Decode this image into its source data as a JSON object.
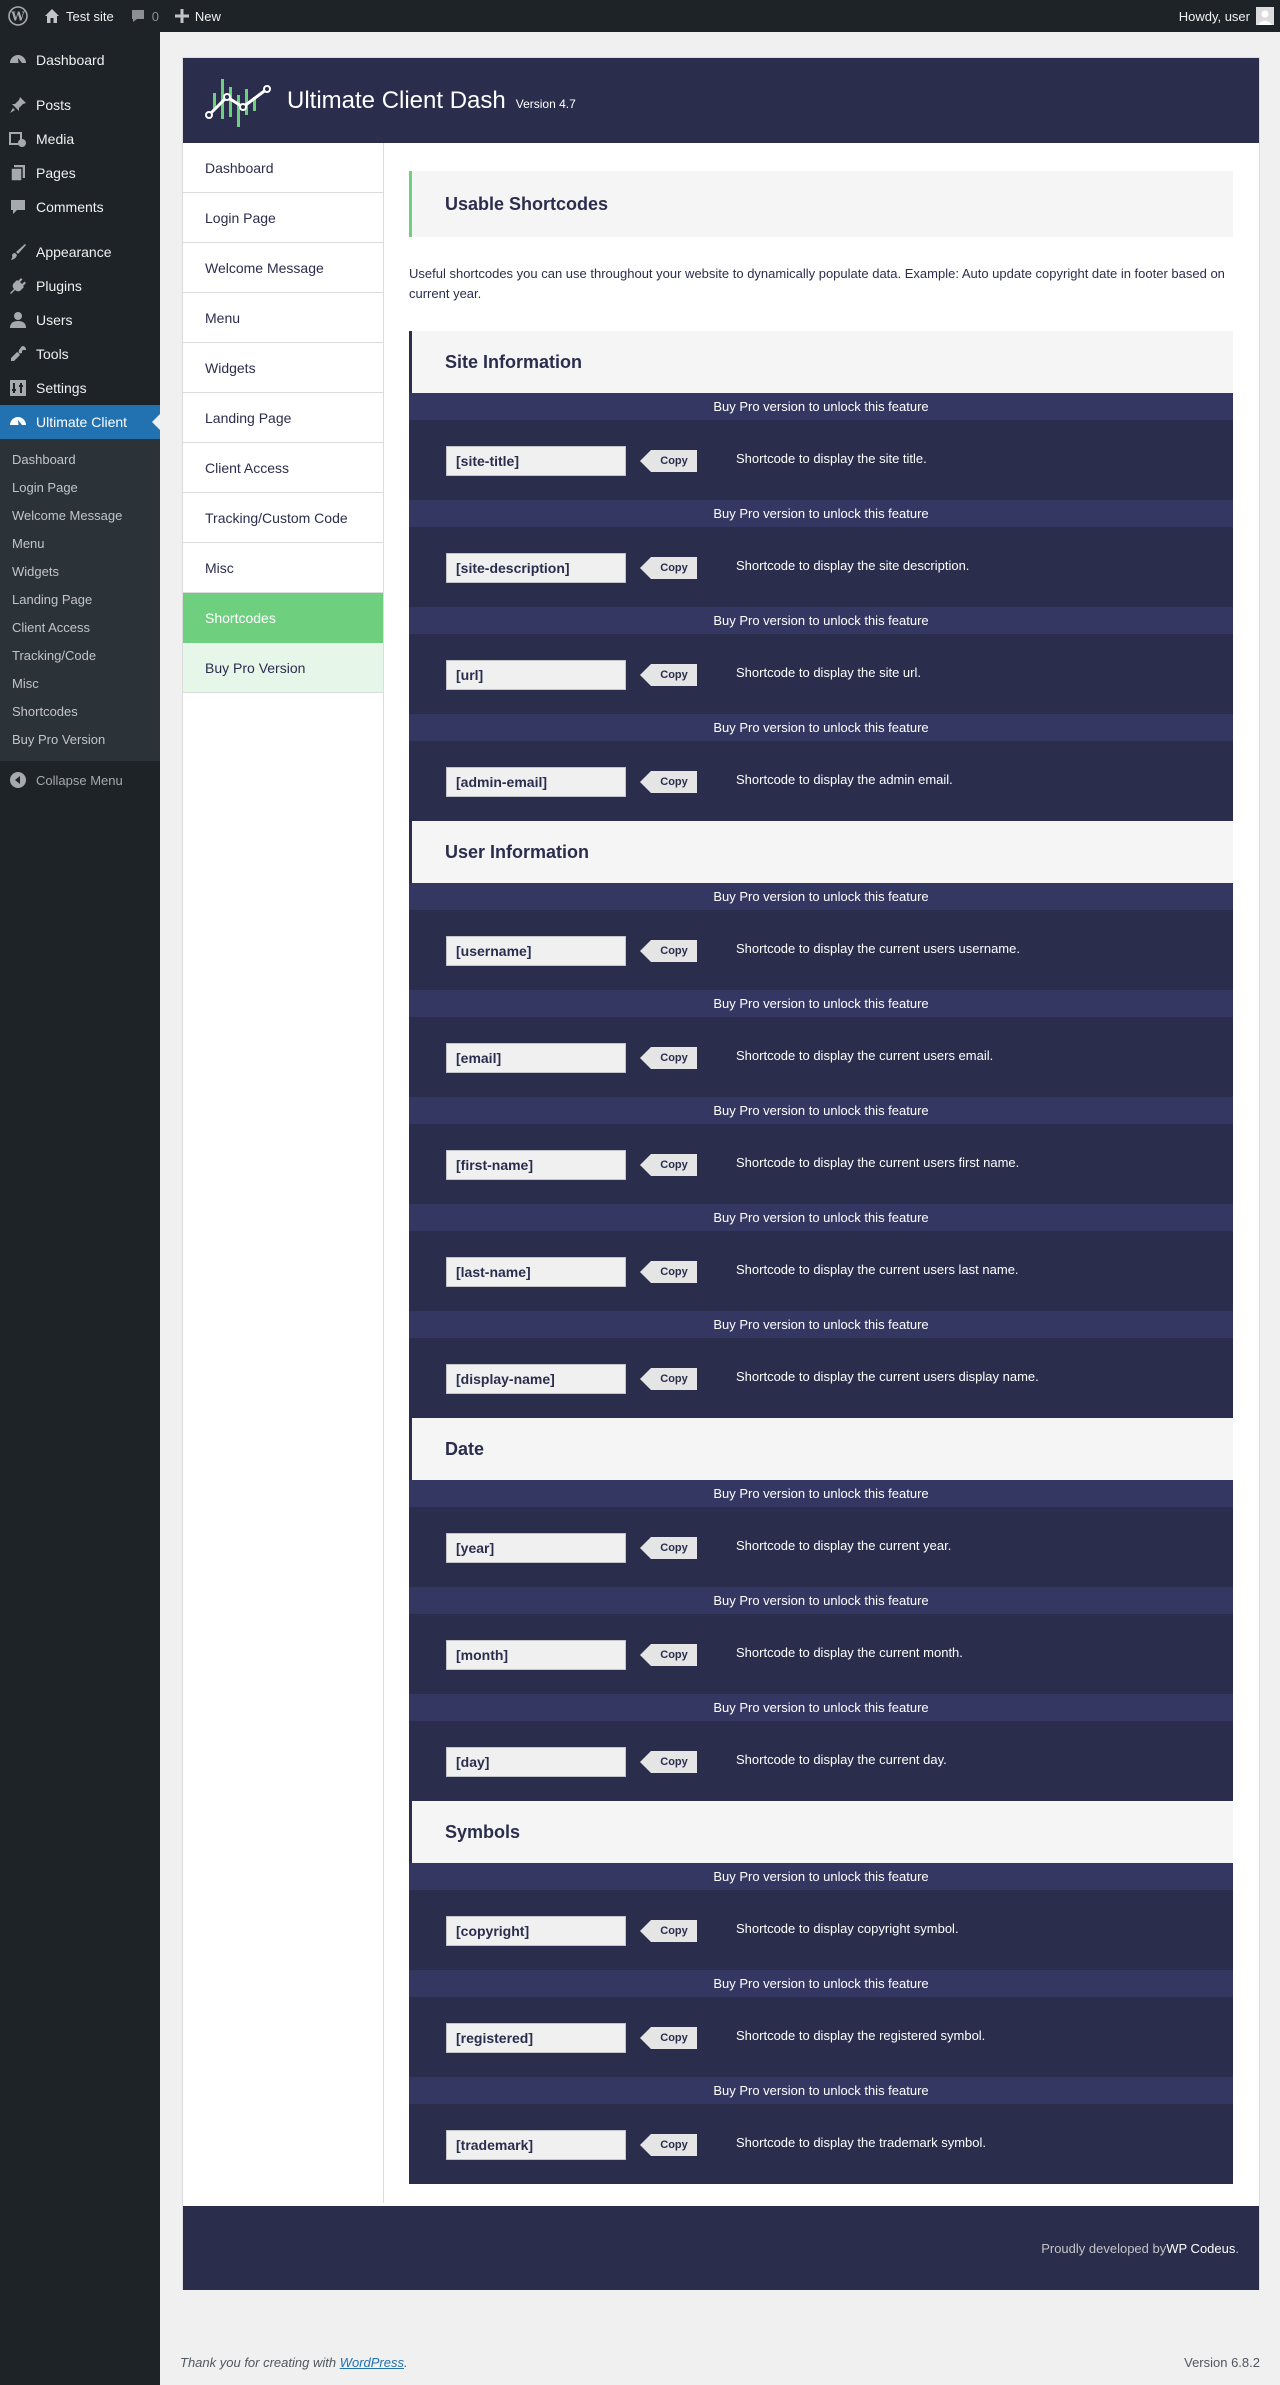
{
  "adminbar": {
    "site_name": "Test site",
    "comments_count": "0",
    "new_label": "New",
    "howdy": "Howdy, user"
  },
  "sidebar": {
    "items": [
      {
        "label": "Dashboard",
        "icon": "dashboard-icon"
      },
      {
        "label": "Posts",
        "icon": "pin-icon"
      },
      {
        "label": "Media",
        "icon": "media-icon"
      },
      {
        "label": "Pages",
        "icon": "pages-icon"
      },
      {
        "label": "Comments",
        "icon": "comment-icon"
      },
      {
        "label": "Appearance",
        "icon": "brush-icon"
      },
      {
        "label": "Plugins",
        "icon": "plug-icon"
      },
      {
        "label": "Users",
        "icon": "user-icon"
      },
      {
        "label": "Tools",
        "icon": "wrench-icon"
      },
      {
        "label": "Settings",
        "icon": "settings-icon"
      },
      {
        "label": "Ultimate Client",
        "icon": "dashboard-icon"
      }
    ],
    "submenu": [
      "Dashboard",
      "Login Page",
      "Welcome Message",
      "Menu",
      "Widgets",
      "Landing Page",
      "Client Access",
      "Tracking/Code",
      "Misc",
      "Shortcodes",
      "Buy Pro Version"
    ],
    "collapse_label": "Collapse Menu"
  },
  "plugin": {
    "title": "Ultimate Client Dash",
    "version": "Version 4.7",
    "nav": [
      "Dashboard",
      "Login Page",
      "Welcome Message",
      "Menu",
      "Widgets",
      "Landing Page",
      "Client Access",
      "Tracking/Custom Code",
      "Misc",
      "Shortcodes",
      "Buy Pro Version"
    ],
    "page_title": "Usable Shortcodes",
    "description": "Useful shortcodes you can use throughout your website to dynamically populate data. Example: Auto update copyright date in footer based on current year.",
    "pro_text": "Buy Pro version to unlock this feature",
    "copy_label": "Copy",
    "sections": [
      {
        "title": "Site Information",
        "rows": [
          {
            "code": "[site-title]",
            "desc": "Shortcode to display the site title."
          },
          {
            "code": "[site-description]",
            "desc": "Shortcode to display the site description."
          },
          {
            "code": "[url]",
            "desc": "Shortcode to display the site url."
          },
          {
            "code": "[admin-email]",
            "desc": "Shortcode to display the admin email."
          }
        ]
      },
      {
        "title": "User Information",
        "rows": [
          {
            "code": "[username]",
            "desc": "Shortcode to display the current users username."
          },
          {
            "code": "[email]",
            "desc": "Shortcode to display the current users email."
          },
          {
            "code": "[first-name]",
            "desc": "Shortcode to display the current users first name."
          },
          {
            "code": "[last-name]",
            "desc": "Shortcode to display the current users last name."
          },
          {
            "code": "[display-name]",
            "desc": "Shortcode to display the current users display name."
          }
        ]
      },
      {
        "title": "Date",
        "rows": [
          {
            "code": "[year]",
            "desc": "Shortcode to display the current year."
          },
          {
            "code": "[month]",
            "desc": "Shortcode to display the current month."
          },
          {
            "code": "[day]",
            "desc": "Shortcode to display the current day."
          }
        ]
      },
      {
        "title": "Symbols",
        "rows": [
          {
            "code": "[copyright]",
            "desc": "Shortcode to display copyright symbol."
          },
          {
            "code": "[registered]",
            "desc": "Shortcode to display the registered symbol."
          },
          {
            "code": "[trademark]",
            "desc": "Shortcode to display the trademark symbol."
          }
        ]
      }
    ],
    "footer_text": "Proudly developed by ",
    "footer_link": "WP Codeus",
    "footer_end": "."
  },
  "wpfooter": {
    "thanks": "Thank you for creating with ",
    "wp_link": "WordPress",
    "thanks_end": ".",
    "version": "Version 6.8.2"
  },
  "colors": {
    "header": "#2b2d4d",
    "accent": "#6ed07f",
    "wp_blue": "#2271b1"
  }
}
